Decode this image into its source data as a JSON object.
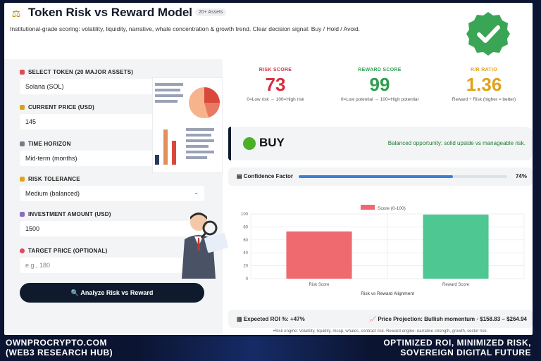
{
  "header": {
    "title": "Token Risk vs Reward Model",
    "badge": "20+ Assets",
    "subtitle": "Institutional-grade scoring: volatility, liquidity, narrative, whale concentration & growth trend. Clear decision signal: Buy / Hold / Avoid."
  },
  "form": {
    "token": {
      "label": "SELECT TOKEN (20 MAJOR ASSETS)",
      "value": "Solana (SOL)",
      "icon": "pin-icon"
    },
    "price": {
      "label": "CURRENT PRICE (USD)",
      "value": "145",
      "icon": "price-icon"
    },
    "horizon": {
      "label": "TIME HORIZON",
      "value": "Mid-term (months)",
      "icon": "clock-icon"
    },
    "risk": {
      "label": "RISK TOLERANCE",
      "value": "Medium (balanced)",
      "icon": "warning-icon"
    },
    "investment": {
      "label": "INVESTMENT AMOUNT (USD)",
      "value": "1500",
      "icon": "money-icon"
    },
    "target": {
      "label": "TARGET PRICE (OPTIONAL)",
      "placeholder": "e.g., 180",
      "icon": "target-icon"
    },
    "analyze_label": "Analyze Risk vs Reward"
  },
  "cards": {
    "risk": {
      "label": "RISK SCORE",
      "value": "73",
      "note": "0=Low risk → 100=High risk",
      "color": "#d32f3f"
    },
    "reward": {
      "label": "REWARD SCORE",
      "value": "99",
      "note": "0=Low potential → 100=High potential",
      "color": "#2e9e4f"
    },
    "ratio": {
      "label": "R/R RATIO",
      "value": "1.36",
      "note": "Reward ÷ Risk (higher = better)",
      "color": "#e0a21b"
    }
  },
  "signal": {
    "label": "BUY",
    "description": "Balanced opportunity: solid upside vs manageable risk."
  },
  "confidence": {
    "label": "Confidence Factor",
    "value": 74,
    "value_text": "74%"
  },
  "chart_data": {
    "type": "bar",
    "categories": [
      "Risk Score",
      "Reward Score"
    ],
    "series": [
      {
        "name": "Score (0-100)",
        "values": [
          73,
          99
        ]
      }
    ],
    "colors": [
      "#ee6a6e",
      "#4fc792"
    ],
    "title": "",
    "xlabel": "Risk vs Reward Alignment",
    "ylabel": "",
    "ylim": [
      0,
      100
    ],
    "yticks": [
      0,
      20,
      40,
      60,
      80,
      100
    ],
    "legend": "top-center",
    "grid": true
  },
  "footer": {
    "roi": "Expected ROI %: +47%",
    "projection": "Price Projection: Bullish momentum · $158.83 – $264.94",
    "note": "•Risk engine: Volatility, liquidity, mcap, whales, contract risk. Reward engine: narrative strength, growth, sector risk."
  },
  "banner": {
    "left_line1": "OWNPROCRYPTO.COM",
    "left_line2": "(WEB3 RESEARCH HUB)",
    "right_line1": "OPTIMIZED ROI, MINIMIZED RISK,",
    "right_line2": "SOVEREIGN DIGITAL FUTURE"
  }
}
